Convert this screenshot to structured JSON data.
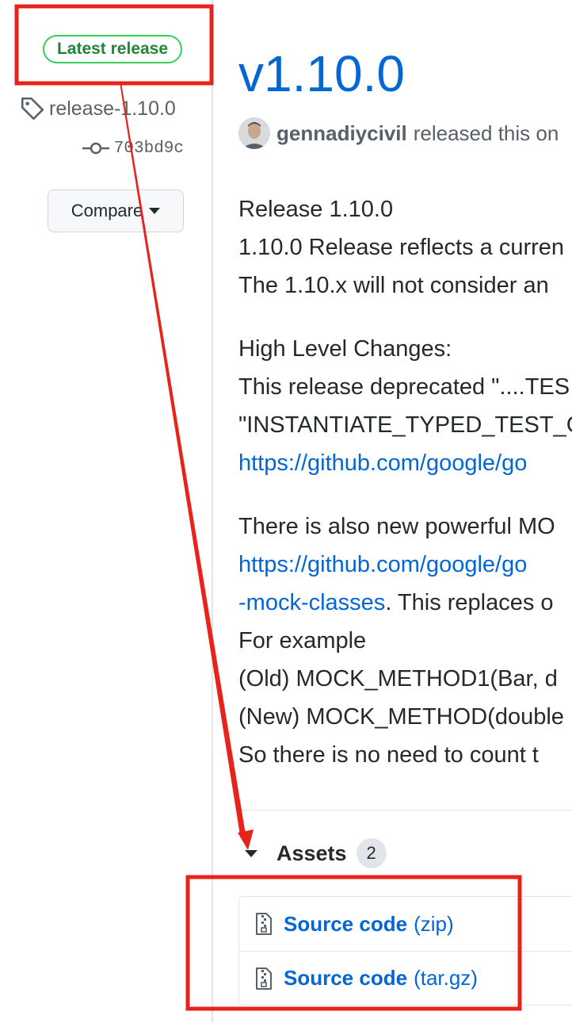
{
  "sidebar": {
    "badge": "Latest release",
    "tag": "release-1.10.0",
    "commit": "703bd9c",
    "compare_label": "Compare"
  },
  "release": {
    "title": "v1.10.0",
    "author": "gennadiycivil",
    "released_text": "released this on",
    "body": {
      "p1": [
        "Release 1.10.0",
        "1.10.0 Release reflects a curren",
        "The 1.10.x will not consider an"
      ],
      "p2": [
        "High Level Changes:",
        "This release deprecated \"....TES",
        "\"INSTANTIATE_TYPED_TEST_CA"
      ],
      "p2_link": "https://github.com/google/go",
      "p3_line1": "There is also new powerful MO",
      "p3_link1": "https://github.com/google/go",
      "p3_link2": "-mock-classes",
      "p3_after_link": ". This replaces o",
      "p3_rest": [
        "For example",
        "(Old) MOCK_METHOD1(Bar, d",
        "(New) MOCK_METHOD(double",
        "So there is no need to count t"
      ]
    }
  },
  "assets": {
    "label": "Assets",
    "count": "2",
    "items": [
      {
        "name": "Source code",
        "type": "(zip)"
      },
      {
        "name": "Source code",
        "type": "(tar.gz)"
      }
    ]
  },
  "colors": {
    "link": "#0366d6",
    "badge_green": "#22863a",
    "annotation_red": "#e8231b"
  }
}
